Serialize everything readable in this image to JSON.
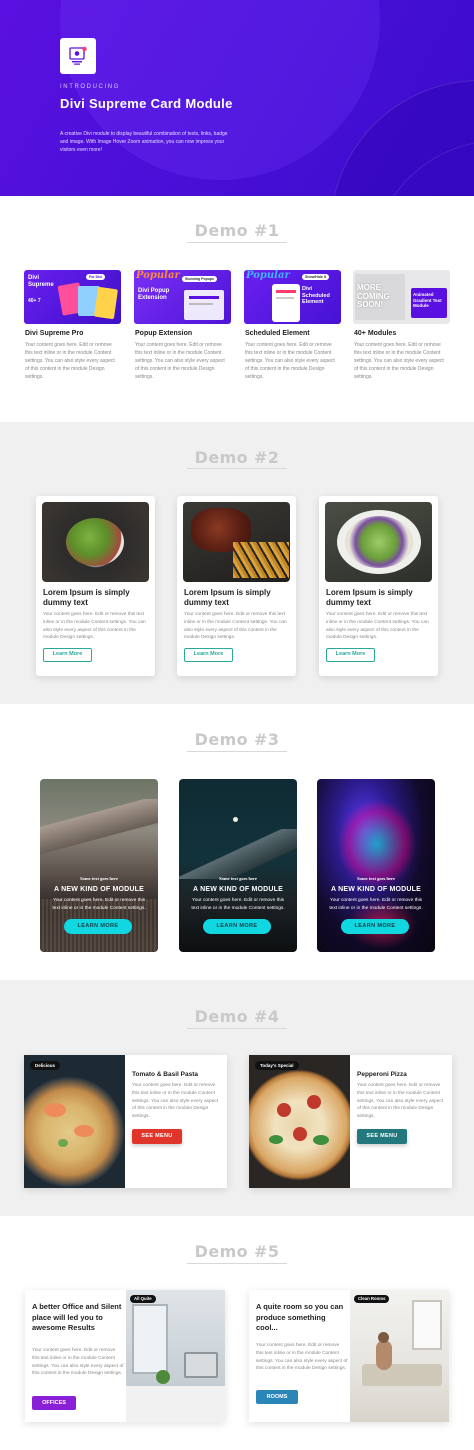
{
  "hero": {
    "intro": "INTRODUCING",
    "title": "Divi Supreme Card Module",
    "description": "A creative Divi module to display beautiful combination of texts, links, badge and image. With Image Hover Zoom animation, you can now impress your visitors even more!",
    "logo_icon": "module-icon"
  },
  "demo1": {
    "title": "Demo #1",
    "cards": [
      {
        "title": "Divi Supreme Pro",
        "text": "Your content goes here. Edit or remove this text inline or in the module Content settings. You can also style every aspect of this content in the module Design settings.",
        "img_label": "Divi Supreme",
        "img_badge": "For Divi",
        "img_stats": "40+  7"
      },
      {
        "title": "Popup Extension",
        "text": "Your content goes here. Edit or remove this text inline or in the module Content settings. You can also style every aspect of this content in the module Design settings.",
        "img_label": "Divi Popup Extension",
        "img_badge": "Stunning Popups",
        "img_script": "Popular"
      },
      {
        "title": "Scheduled Element",
        "text": "Your content goes here. Edit or remove this text inline or in the module Content settings. You can also style every aspect of this content in the module Design settings.",
        "img_label": "Divi Scheduled Element",
        "img_badge": "Show/Hide It",
        "img_script": "Popular"
      },
      {
        "title": "40+ Modules",
        "text": "Your content goes here. Edit or remove this text inline or in the module Content settings. You can also style every aspect of this content in the module Design settings.",
        "img_label": "MORE COMING SOON!",
        "img_badge": "Animated Gradient Text Module"
      }
    ]
  },
  "demo2": {
    "title": "Demo #2",
    "cards": [
      {
        "title": "Lorem Ipsum is simply dummy text",
        "text": "Your content goes here. Edit or remove this text inline or in the module Content settings. You can also style every aspect of this content in the module Design settings.",
        "button": "Learn More"
      },
      {
        "title": "Lorem Ipsum is simply dummy text",
        "text": "Your content goes here. Edit or remove this text inline or in the module Content settings. You can also style every aspect of this content in the module Design settings.",
        "button": "Learn More"
      },
      {
        "title": "Lorem Ipsum is simply dummy text",
        "text": "Your content goes here. Edit or remove this text inline or in the module Content settings. You can also style every aspect of this content in the module Design settings.",
        "button": "Learn More"
      }
    ]
  },
  "demo3": {
    "title": "Demo #3",
    "cards": [
      {
        "subtitle": "Some text goes here",
        "title": "A NEW KIND OF MODULE",
        "text": "Your content goes here. Edit or remove this text inline or in the module Content settings.",
        "button": "LEARN MORE"
      },
      {
        "subtitle": "Some text goes here",
        "title": "A NEW KIND OF MODULE",
        "text": "Your content goes here. Edit or remove this text inline or in the module Content settings.",
        "button": "LEARN MORE"
      },
      {
        "subtitle": "Some text goes here",
        "title": "A NEW KIND OF MODULE",
        "text": "Your content goes here. Edit or remove this text inline or in the module Content settings.",
        "button": "LEARN MORE"
      }
    ]
  },
  "demo4": {
    "title": "Demo #4",
    "cards": [
      {
        "badge": "Delicious",
        "title": "Tomato & Basil Pasta",
        "text": "Your content goes here. Edit or remove this text inline or in the module Content settings. You can also style every aspect of this content in the module Design settings.",
        "button": "SEE MENU",
        "button_color": "#e0352b"
      },
      {
        "badge": "Today's Special",
        "title": "Pepperoni Pizza",
        "text": "Your content goes here. Edit or remove this text inline or in the module Content settings. You can also style every aspect of this content in the module Design settings.",
        "button": "SEE MENU",
        "button_color": "#23787e"
      }
    ]
  },
  "demo5": {
    "title": "Demo #5",
    "cards": [
      {
        "title": "A better Office and Silent place will led you to awesome Results",
        "text": "Your content goes here. Edit or remove this text inline or in the module Content settings. You can also style every aspect of this content in the module Design settings.",
        "button": "OFFICES",
        "badge": "All Quite",
        "button_color": "#8a1fd8"
      },
      {
        "title": "A quite room so you can produce something cool...",
        "text": "Your content goes here. Edit or remove this text inline or in the module Content settings. You can also style every aspect of this content in the module Design settings.",
        "button": "ROOMS",
        "badge": "Clean Rooms",
        "button_color": "#2b86b8"
      }
    ]
  }
}
